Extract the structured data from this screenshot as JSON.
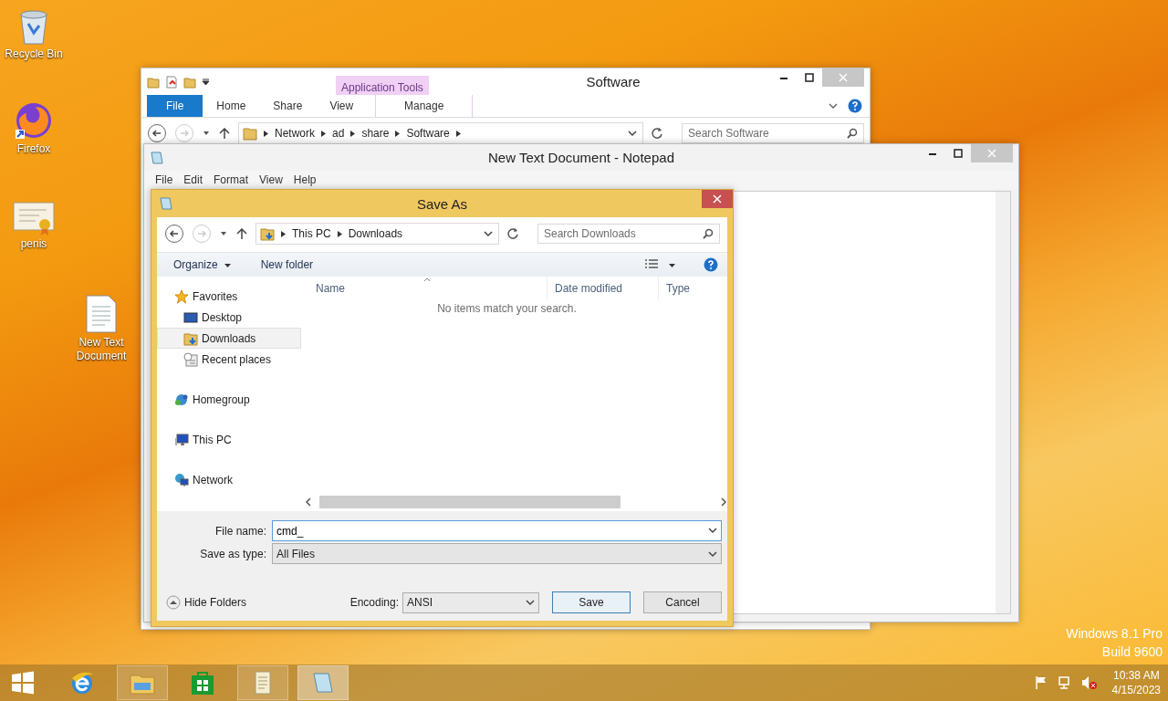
{
  "desktop_icons": [
    {
      "label": "Recycle Bin",
      "kind": "recycle-bin"
    },
    {
      "label": "Firefox",
      "kind": "firefox"
    },
    {
      "label": "penis",
      "kind": "certificate"
    },
    {
      "label": "New Text Document",
      "kind": "text-file"
    }
  ],
  "explorer": {
    "title": "Software",
    "context_group": "Application Tools",
    "ribbon_tabs": [
      {
        "label": "File",
        "kind": "file"
      },
      {
        "label": "Home",
        "kind": "tab"
      },
      {
        "label": "Share",
        "kind": "tab"
      },
      {
        "label": "View",
        "kind": "tab"
      },
      {
        "label": "Manage",
        "kind": "context"
      }
    ],
    "breadcrumb": [
      "Network",
      "ad",
      "share",
      "Software"
    ],
    "search": {
      "placeholder": "Search Software"
    }
  },
  "notepad": {
    "title": "New Text Document - Notepad",
    "menu": [
      "File",
      "Edit",
      "Format",
      "View",
      "Help"
    ]
  },
  "save_dialog": {
    "title": "Save As",
    "breadcrumb": [
      "This PC",
      "Downloads"
    ],
    "search": {
      "placeholder": "Search Downloads"
    },
    "organize": "Organize",
    "new_folder": "New folder",
    "nav": [
      {
        "label": "Favorites",
        "kind": "favorites",
        "selected": false,
        "children": [
          {
            "label": "Desktop",
            "kind": "desktop",
            "selected": false
          },
          {
            "label": "Downloads",
            "kind": "downloads",
            "selected": true
          },
          {
            "label": "Recent places",
            "kind": "recent",
            "selected": false
          }
        ]
      },
      {
        "label": "Homegroup",
        "kind": "homegroup",
        "selected": false
      },
      {
        "label": "This PC",
        "kind": "pc",
        "selected": false
      },
      {
        "label": "Network",
        "kind": "network",
        "selected": false
      }
    ],
    "columns": [
      "Name",
      "Date modified",
      "Type"
    ],
    "empty_message": "No items match your search.",
    "file_name": {
      "label": "File name:",
      "value": "cmd_"
    },
    "save_as_type": {
      "label": "Save as type:",
      "value": "All Files"
    },
    "hide_folders": "Hide Folders",
    "encoding": {
      "label": "Encoding:",
      "value": "ANSI"
    },
    "buttons": [
      {
        "label": "Save",
        "default": true
      },
      {
        "label": "Cancel",
        "default": false
      }
    ]
  },
  "os_edition": {
    "name": "Windows 8.1 Pro",
    "build": "Build 9600"
  },
  "taskbar": {
    "apps": [
      {
        "kind": "browser",
        "running": false,
        "active": false
      },
      {
        "kind": "explorer",
        "running": true,
        "active": false
      },
      {
        "kind": "store",
        "running": false,
        "active": false
      },
      {
        "kind": "scroll",
        "running": true,
        "active": false
      },
      {
        "kind": "notepad",
        "running": true,
        "active": true
      }
    ],
    "time": "10:38 AM",
    "date": "4/15/2023"
  }
}
